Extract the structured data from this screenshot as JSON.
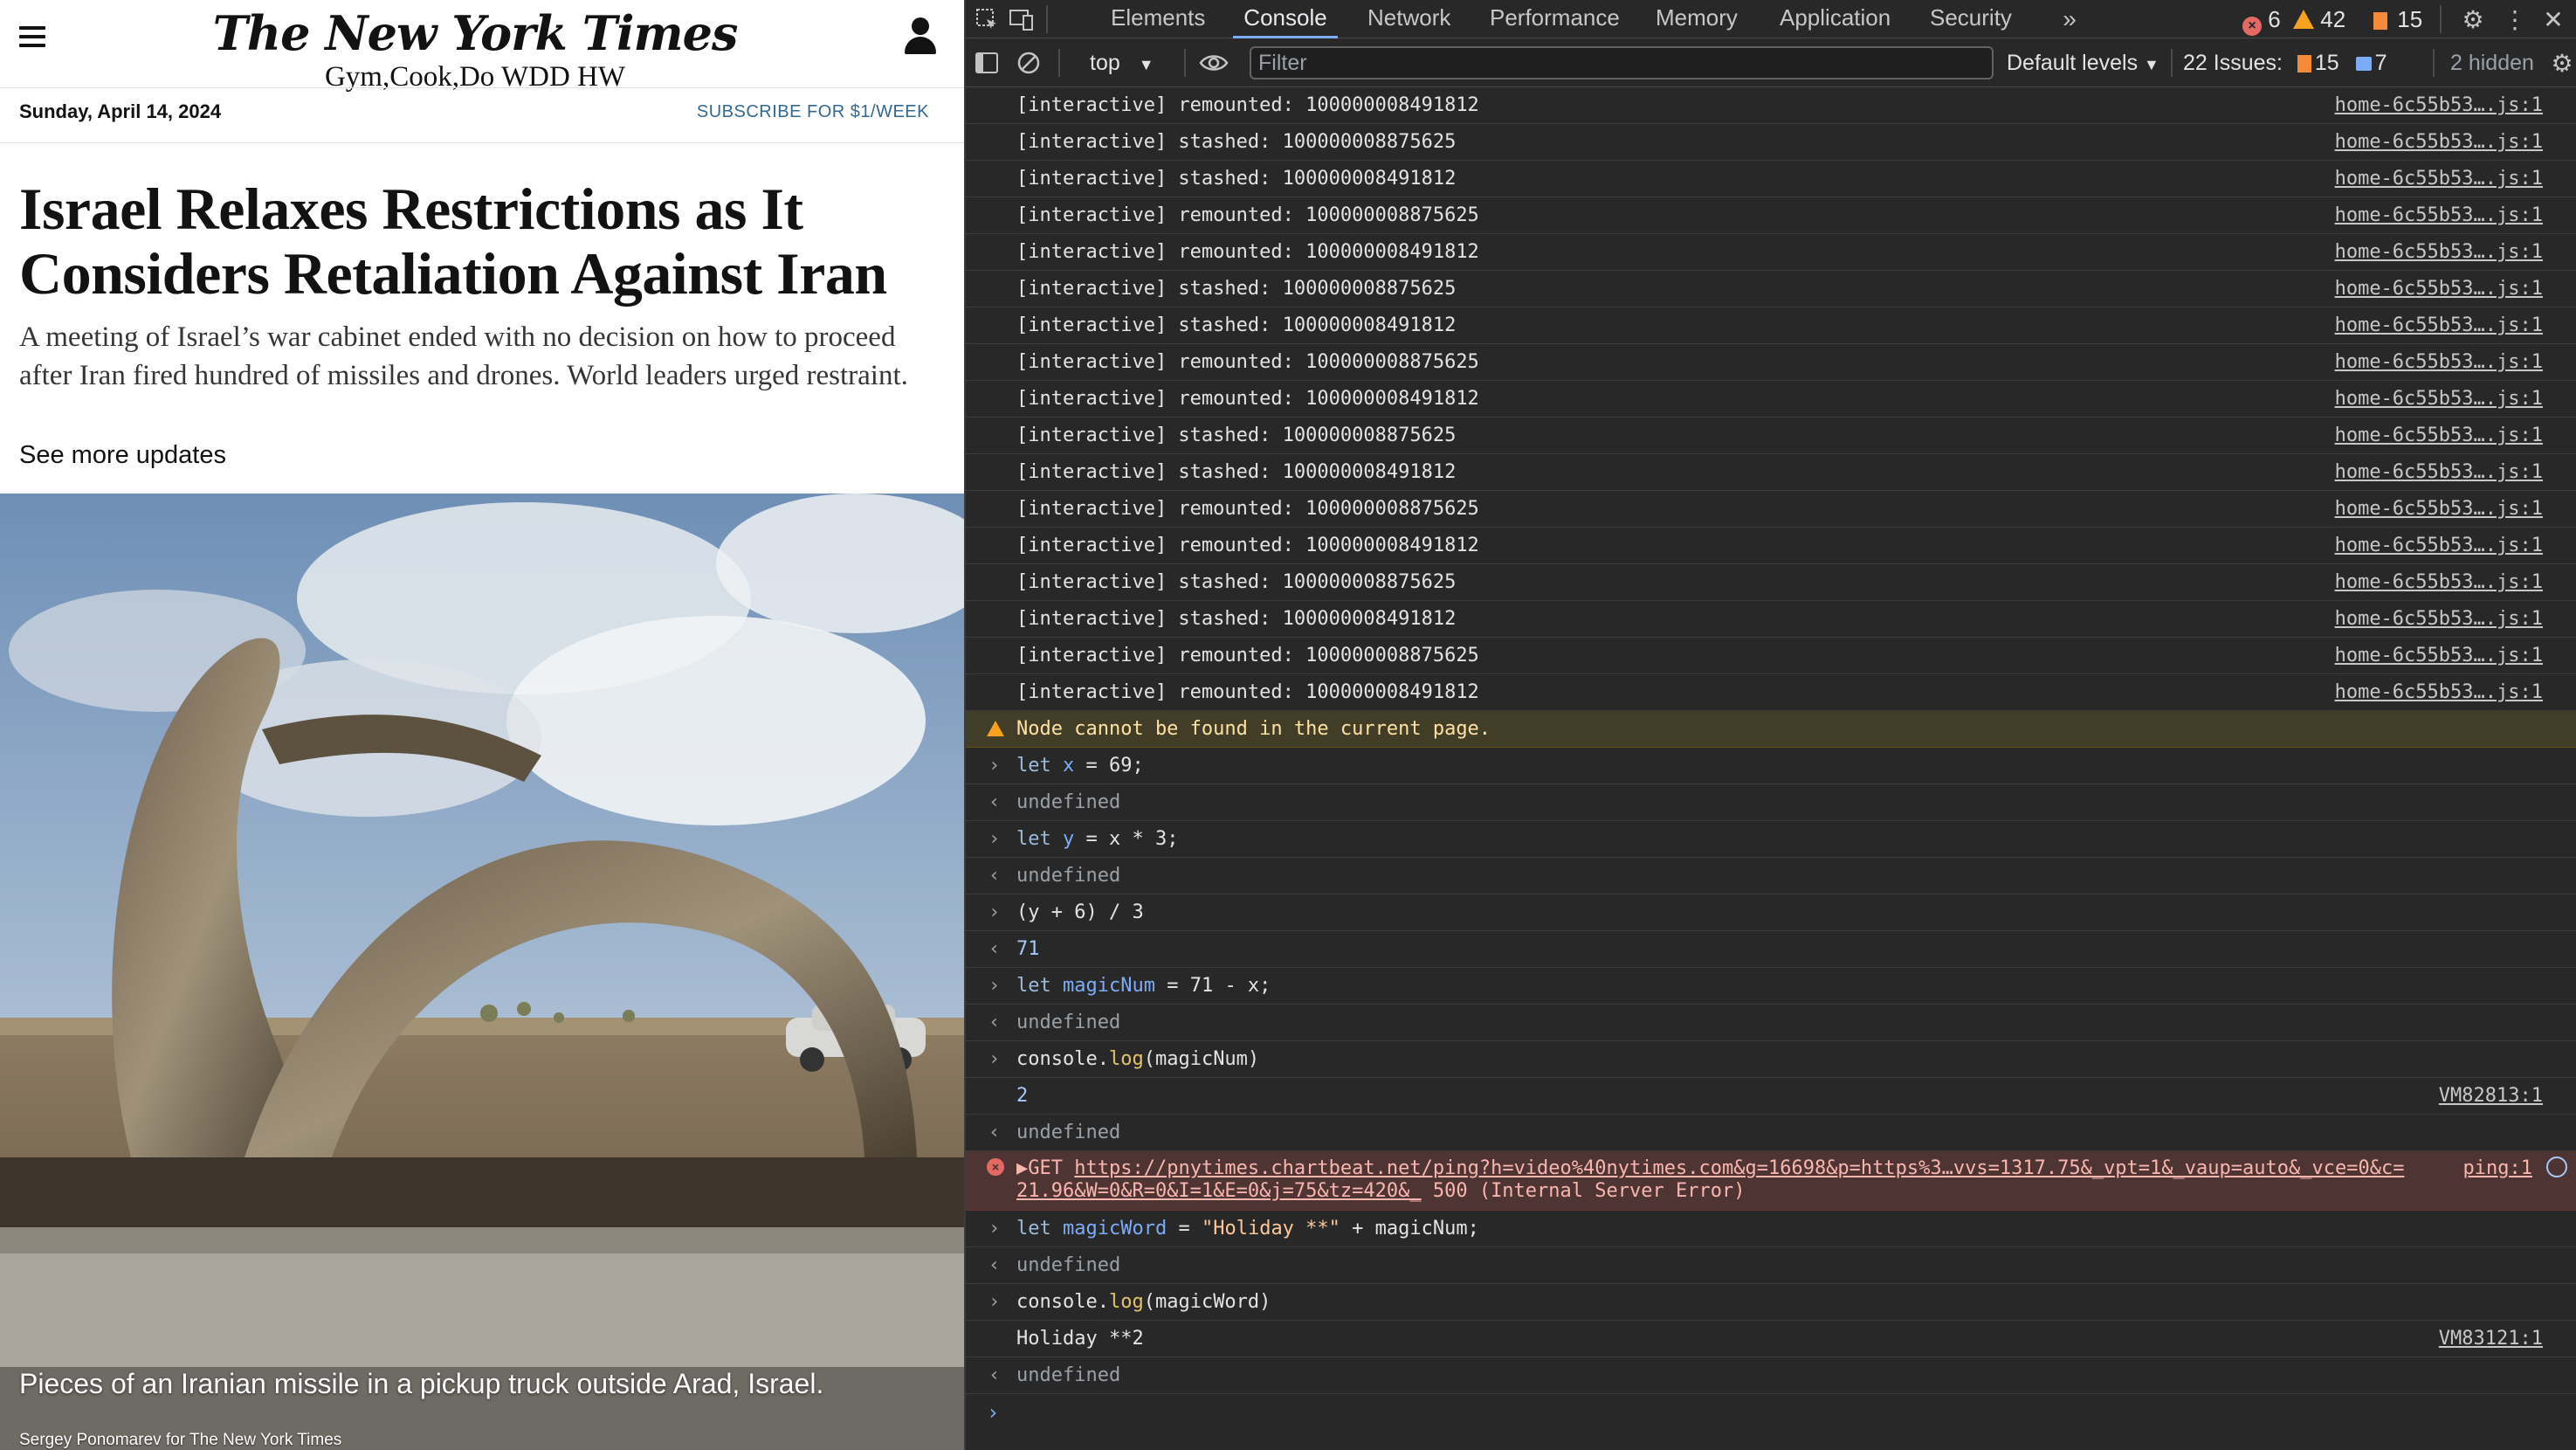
{
  "nyt": {
    "logo": "The New York Times",
    "logo_sub": "Gym,Cook,Do WDD HW",
    "date": "Sunday, April 14, 2024",
    "subscribe": "SUBSCRIBE FOR $1/WEEK",
    "headline": "Israel Relaxes Restrictions as It Considers Retaliation Against Iran",
    "summary": "A meeting of Israel’s war cabinet ended with no decision on how to proceed after Iran fired hundred of missiles and drones. World leaders urged restraint.",
    "more_link": "See more updates",
    "caption": "Pieces of an Iranian missile in a pickup truck outside Arad, Israel.",
    "credit": "Sergey Ponomarev for The New York Times"
  },
  "devtools": {
    "tabs": [
      "Elements",
      "Console",
      "Network",
      "Performance",
      "Memory",
      "Application",
      "Security"
    ],
    "active_tab": "Console",
    "error_count": "6",
    "warning_count": "42",
    "info_count": "15",
    "context": "top",
    "filter_placeholder": "Filter",
    "levels": "Default levels",
    "issues_label": "22 Issues:",
    "issues_warn": "15",
    "issues_info": "7",
    "hidden": "2 hidden",
    "log_source": "home-6c55b53….js:1",
    "logs": [
      "[interactive] remounted: 100000008491812",
      "[interactive] stashed: 100000008875625",
      "[interactive] stashed: 100000008491812",
      "[interactive] remounted: 100000008875625",
      "[interactive] remounted: 100000008491812",
      "[interactive] stashed: 100000008875625",
      "[interactive] stashed: 100000008491812",
      "[interactive] remounted: 100000008875625",
      "[interactive] remounted: 100000008491812",
      "[interactive] stashed: 100000008875625",
      "[interactive] stashed: 100000008491812",
      "[interactive] remounted: 100000008875625",
      "[interactive] remounted: 100000008491812",
      "[interactive] stashed: 100000008875625",
      "[interactive] stashed: 100000008491812",
      "[interactive] remounted: 100000008875625",
      "[interactive] remounted: 100000008491812"
    ],
    "warning": "Node cannot be found in the current page.",
    "cmd1": {
      "kw": "let",
      "var": "x",
      "rest": " = 69;"
    },
    "undefined": "undefined",
    "cmd2": {
      "kw": "let",
      "var": "y",
      "rest": " = x * 3;"
    },
    "cmd3": "(y + 6) / 3",
    "result3": "71",
    "cmd4": {
      "kw": "let",
      "var": "magicNum",
      "rest": " = 71 - x;"
    },
    "cmd5": {
      "obj": "console.",
      "fn": "log",
      "rest": "(magicNum)"
    },
    "out5": "2",
    "out5_src": "VM82813:1",
    "error": {
      "method": "GET",
      "url": "https://pnytimes.chartbeat.net/ping?h=video%40nytimes.com&g=16698&p=https%3…vvs=1317.75&_vpt=1&_vaup=auto&_vce=0&c=",
      "url2": "21.96&W=0&R=0&I=1&E=0&j=75&tz=420&_",
      "status": " 500 (Internal Server Error)",
      "src": "ping:1"
    },
    "cmd6": {
      "kw": "let",
      "var": "magicWord",
      "mid": " = ",
      "str": "\"Holiday **\"",
      "rest": " + magicNum;"
    },
    "cmd7": {
      "obj": "console.",
      "fn": "log",
      "rest": "(magicWord)"
    },
    "out7": "Holiday **2",
    "out7_src": "VM83121:1"
  }
}
